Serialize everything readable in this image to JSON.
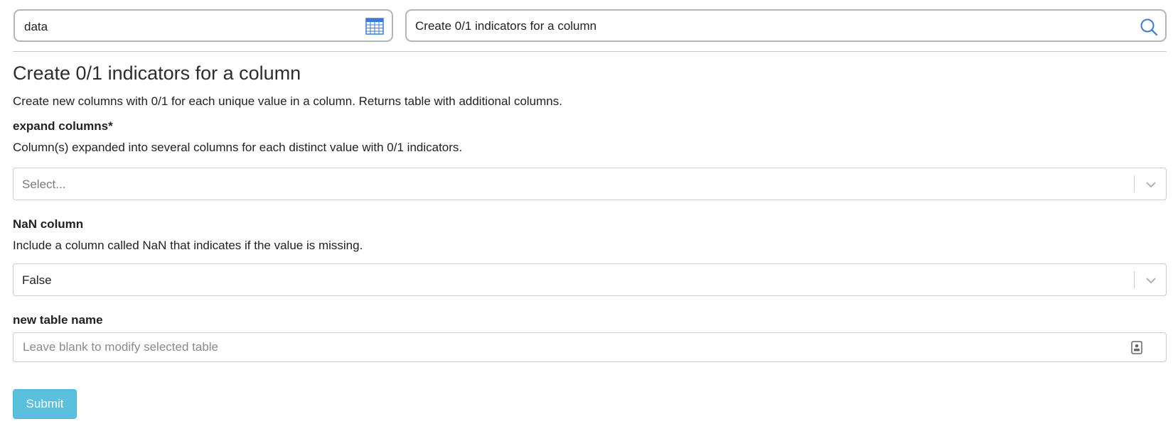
{
  "header": {
    "table_value": "data",
    "search_value": "Create 0/1 indicators for a column"
  },
  "form": {
    "title": "Create 0/1 indicators for a column",
    "description": "Create new columns with 0/1 for each unique value in a column. Returns table with additional columns.",
    "expand_columns": {
      "label": "expand columns*",
      "help": "Column(s) expanded into several columns for each distinct value with 0/1 indicators.",
      "placeholder": "Select..."
    },
    "nan_column": {
      "label": "NaN column",
      "help": "Include a column called NaN that indicates if the value is missing.",
      "value": "False"
    },
    "new_table_name": {
      "label": "new table name",
      "placeholder": "Leave blank to modify selected table",
      "value": ""
    },
    "submit_label": "Submit"
  },
  "icons": {
    "table": "table-grid-icon",
    "search": "search-icon",
    "chevron": "chevron-down-icon",
    "id_card": "contact-card-icon"
  },
  "colors": {
    "accent": "#5bc0de",
    "icon_blue": "#3a7bd5"
  }
}
